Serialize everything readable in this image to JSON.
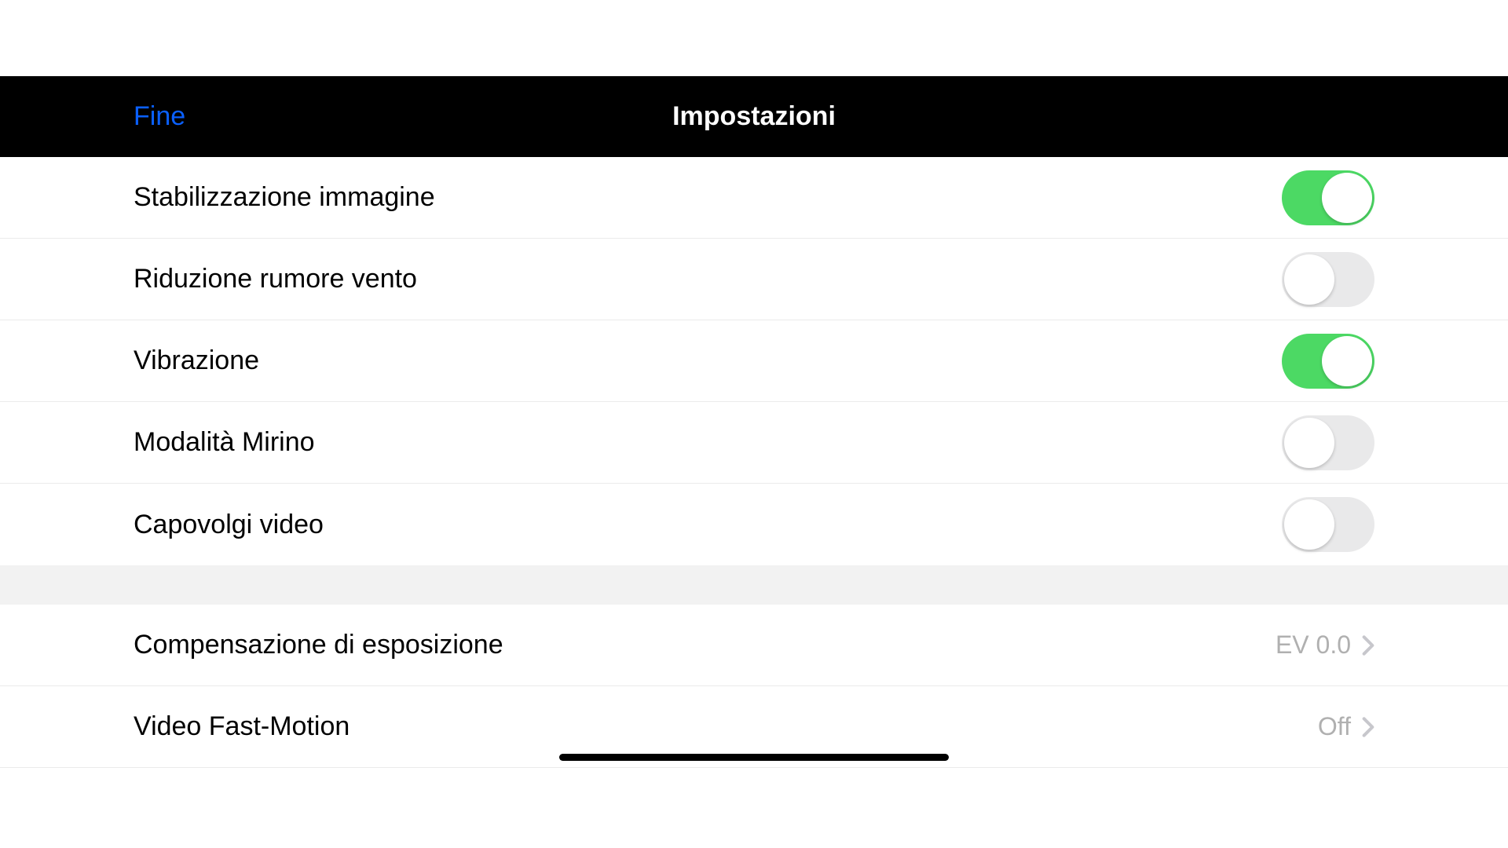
{
  "header": {
    "done_label": "Fine",
    "title": "Impostazioni"
  },
  "toggle_settings": [
    {
      "label": "Stabilizzazione immagine",
      "on": true
    },
    {
      "label": "Riduzione rumore vento",
      "on": false
    },
    {
      "label": "Vibrazione",
      "on": true
    },
    {
      "label": "Modalità Mirino",
      "on": false
    },
    {
      "label": "Capovolgi video",
      "on": false
    }
  ],
  "value_settings": [
    {
      "label": "Compensazione di esposizione",
      "value": "EV 0.0"
    },
    {
      "label": "Video Fast-Motion",
      "value": "Off"
    }
  ]
}
